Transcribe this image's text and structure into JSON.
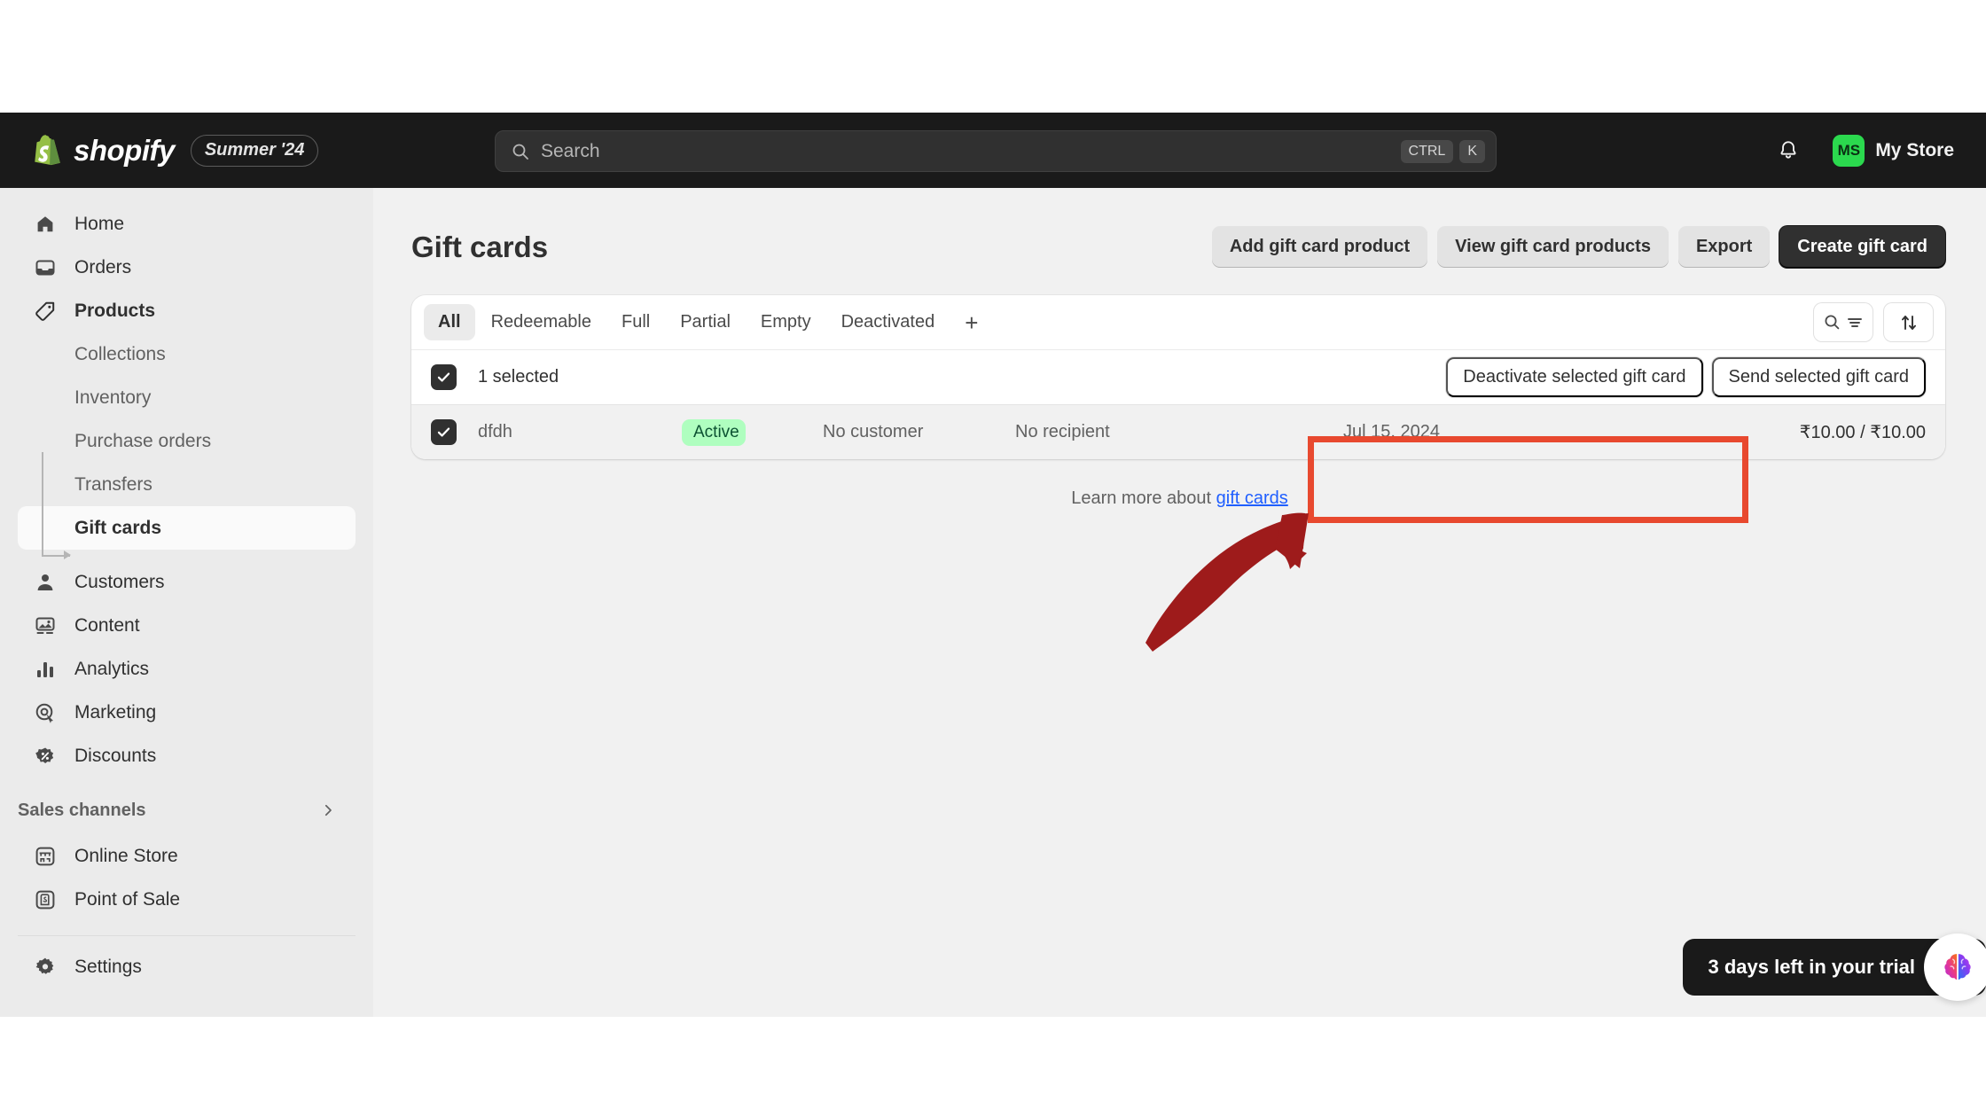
{
  "topbar": {
    "brand_name": "shopify",
    "season_badge": "Summer '24",
    "search_placeholder": "Search",
    "search_value": "",
    "kbd_ctrl": "CTRL",
    "kbd_key": "K",
    "store_initials": "MS",
    "store_name": "My Store",
    "accent_green": "#2bd94e"
  },
  "sidebar": {
    "items": [
      {
        "label": "Home",
        "icon": "home-icon"
      },
      {
        "label": "Orders",
        "icon": "orders-icon"
      },
      {
        "label": "Products",
        "icon": "tag-icon"
      }
    ],
    "product_subitems": [
      {
        "label": "Collections"
      },
      {
        "label": "Inventory"
      },
      {
        "label": "Purchase orders"
      },
      {
        "label": "Transfers"
      },
      {
        "label": "Gift cards"
      }
    ],
    "items2": [
      {
        "label": "Customers",
        "icon": "person-icon"
      },
      {
        "label": "Content",
        "icon": "content-icon"
      },
      {
        "label": "Analytics",
        "icon": "analytics-icon"
      },
      {
        "label": "Marketing",
        "icon": "marketing-icon"
      },
      {
        "label": "Discounts",
        "icon": "discount-icon"
      }
    ],
    "section_title": "Sales channels",
    "channels": [
      {
        "label": "Online Store",
        "icon": "storefront-icon"
      },
      {
        "label": "Point of Sale",
        "icon": "pos-icon"
      }
    ],
    "settings_label": "Settings",
    "active_item": "Gift cards"
  },
  "page": {
    "title": "Gift cards",
    "actions": [
      {
        "label": "Add gift card product",
        "primary": false
      },
      {
        "label": "View gift card products",
        "primary": false
      },
      {
        "label": "Export",
        "primary": false
      },
      {
        "label": "Create gift card",
        "primary": true
      }
    ]
  },
  "tabs": {
    "items": [
      "All",
      "Redeemable",
      "Full",
      "Partial",
      "Empty",
      "Deactivated"
    ],
    "active": "All",
    "add_label": "+",
    "search_filter_icon": "search-filter-icon",
    "sort_icon": "sort-icon"
  },
  "bulk": {
    "selected_label": "1 selected",
    "actions": [
      "Deactivate selected gift card",
      "Send selected gift card"
    ]
  },
  "table": {
    "rows": [
      {
        "code": "dfdh",
        "status": "Active",
        "customer": "No customer",
        "recipient": "No recipient",
        "date": "Jul 15, 2024",
        "amount": "₹10.00 / ₹10.00"
      }
    ]
  },
  "footer": {
    "learn_prefix": "Learn more about ",
    "learn_link": "gift cards"
  },
  "annotation": {
    "highlight_color": "#e8492f",
    "arrow_color": "#9e1b1b"
  },
  "trial": {
    "text": "3 days left in your trial",
    "fab_icon": "brain-icon"
  }
}
